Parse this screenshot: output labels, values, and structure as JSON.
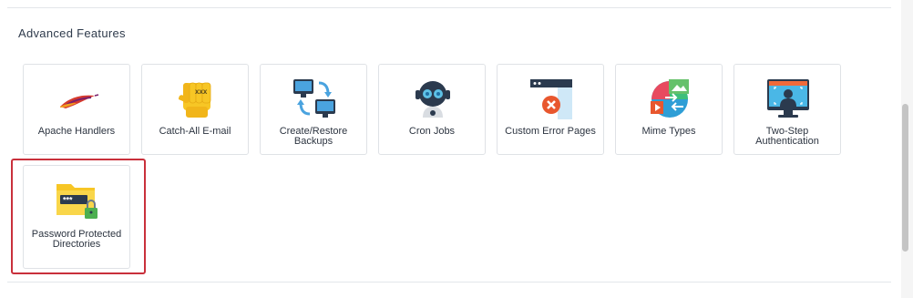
{
  "section": {
    "title": "Advanced Features"
  },
  "tiles": [
    {
      "label": "Apache Handlers",
      "icon": "feather-icon"
    },
    {
      "label": "Catch-All E-mail",
      "icon": "catch-hand-icon"
    },
    {
      "label": "Create/Restore Backups",
      "icon": "backup-computers-icon"
    },
    {
      "label": "Cron Jobs",
      "icon": "robot-icon"
    },
    {
      "label": "Custom Error Pages",
      "icon": "error-page-icon"
    },
    {
      "label": "Mime Types",
      "icon": "mime-types-icon"
    },
    {
      "label": "Two-Step Authentication",
      "icon": "two-step-monitor-icon"
    },
    {
      "label": "Password Protected Directories",
      "icon": "locked-folder-icon"
    }
  ],
  "colors": {
    "highlight": "#c9303b",
    "tile_border": "#dfe2e6",
    "text": "#2c3440"
  }
}
